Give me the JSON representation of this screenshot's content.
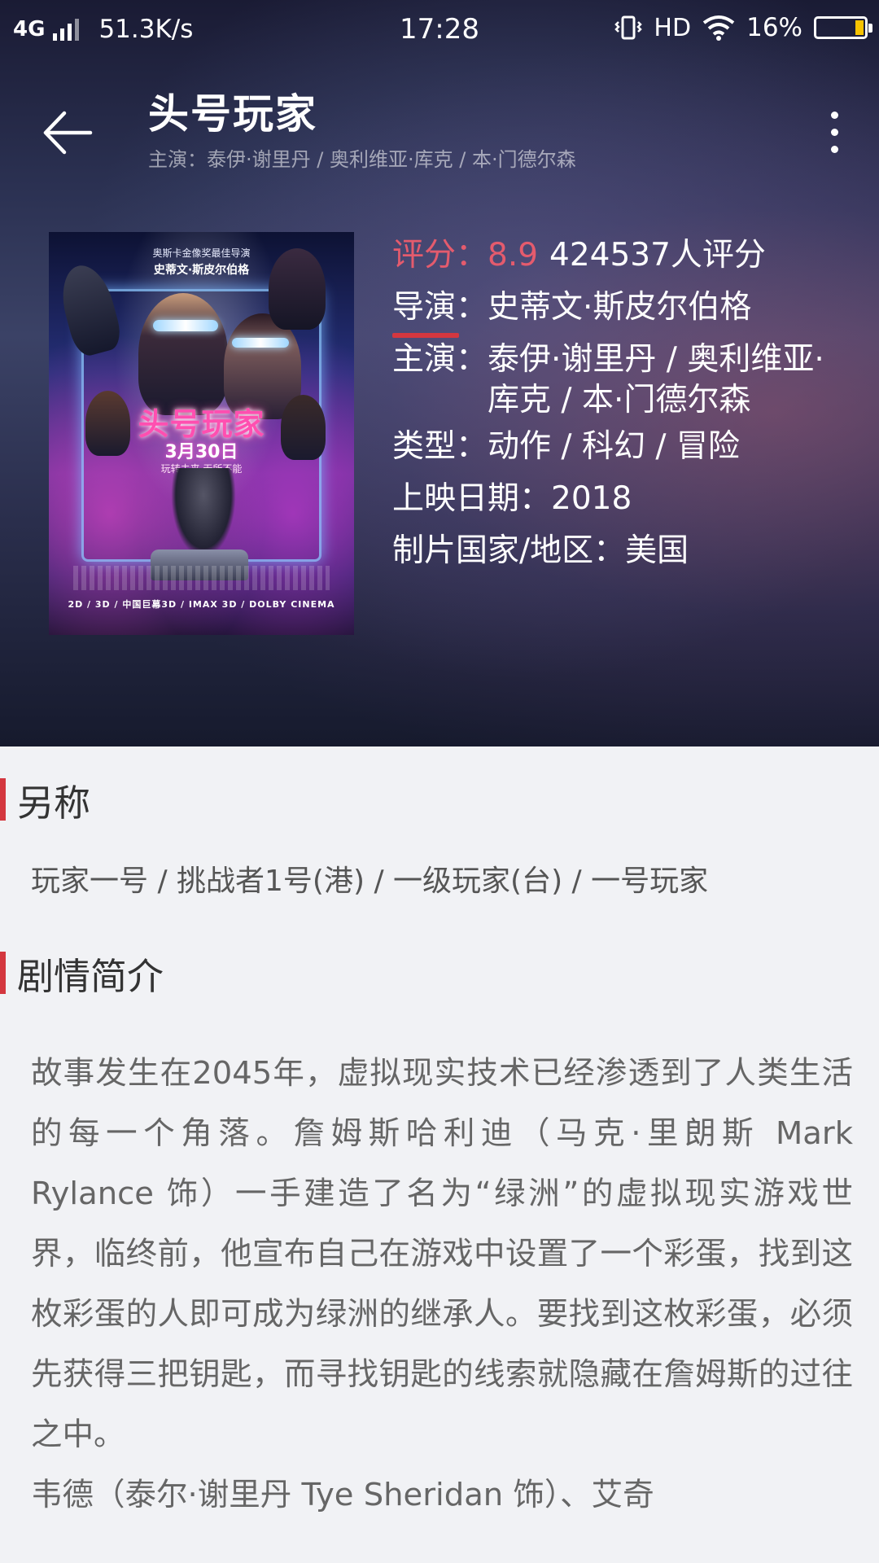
{
  "status_bar": {
    "network": "4G",
    "speed": "51.3K/s",
    "time": "17:28",
    "hd": "HD",
    "battery": "16%",
    "battery_color": "#f7c300"
  },
  "header": {
    "back_icon": "arrow-left-icon",
    "title": "头号玩家",
    "subtitle": "主演：泰伊·谢里丹 /  奥利维亚·库克 / 本·门德尔森",
    "more_icon": "more-vertical-icon"
  },
  "poster": {
    "top_text": "奥斯卡金像奖最佳导演",
    "director": "史蒂文·斯皮尔伯格",
    "title": "头号玩家",
    "date": "3月30日",
    "tagline": "玩转未来 无所不能",
    "formats": "2D / 3D / 中国巨幕3D / IMAX 3D / DOLBY CINEMA"
  },
  "info": {
    "rating_label": "评分：",
    "rating_value": "8.9",
    "rating_count": "424537人评分",
    "director_label": "导演：",
    "director_value": "史蒂文·斯皮尔伯格",
    "actors_label": "主演：",
    "actors_value": "泰伊·谢里丹 /  奥利维亚·库克 / 本·门德尔森",
    "genre_label": "类型：",
    "genre_value": "动作 / 科幻 / 冒险",
    "release_label": "上映日期：",
    "release_value": "2018",
    "country_label": "制片国家/地区：",
    "country_value": "美国",
    "accent_color": "#e45b6d"
  },
  "sections": {
    "aliases_title": "另称",
    "aliases_text": "玩家一号 / 挑战者1号(港) / 一级玩家(台) / 一号玩家",
    "synopsis_title": "剧情简介",
    "synopsis_text": "故事发生在2045年，虚拟现实技术已经渗透到了人类生活的每一个角落。詹姆斯哈利迪（马克·里朗斯 Mark Rylance 饰）一手建造了名为“绿洲”的虚拟现实游戏世界，临终前，他宣布自己在游戏中设置了一个彩蛋，找到这枚彩蛋的人即可成为绿洲的继承人。要找到这枚彩蛋，必须先获得三把钥匙，而寻找钥匙的线索就隐藏在詹姆斯的过往之中。\n韦德（泰尔·谢里丹 Tye Sheridan 饰）、艾奇"
  }
}
